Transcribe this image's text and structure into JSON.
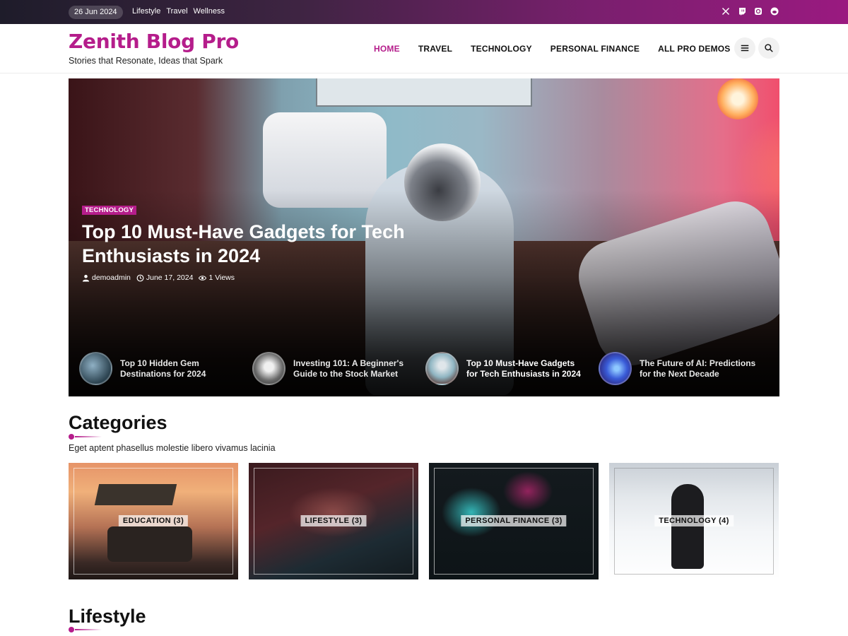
{
  "topbar": {
    "date": "26 Jun 2024",
    "links": [
      "Lifestyle",
      "Travel",
      "Wellness"
    ],
    "socials": [
      "x-icon",
      "twitch-icon",
      "instagram-icon",
      "reddit-icon"
    ]
  },
  "header": {
    "brand_title": "Zenith Blog Pro",
    "tagline": "Stories that Resonate, Ideas that Spark",
    "nav": [
      {
        "label": "HOME",
        "active": true
      },
      {
        "label": "TRAVEL",
        "active": false
      },
      {
        "label": "TECHNOLOGY",
        "active": false
      },
      {
        "label": "PERSONAL FINANCE",
        "active": false
      },
      {
        "label": "ALL PRO DEMOS",
        "active": false,
        "has_dropdown": true
      }
    ],
    "buttons": [
      "hamburger-menu-icon",
      "search-icon"
    ]
  },
  "hero": {
    "category": "TECHNOLOGY",
    "title": "Top 10 Must-Have Gadgets for Tech Enthusiasts in 2024",
    "author": "demoadmin",
    "date": "June 17, 2024",
    "views": "1 Views",
    "thumbs": [
      {
        "title": "Top 10 Hidden Gem Destinations for 2024",
        "current": false
      },
      {
        "title": "Investing 101: A Beginner's Guide to the Stock Market",
        "current": false
      },
      {
        "title": "Top 10 Must-Have Gadgets for Tech Enthusiasts in 2024",
        "current": true
      },
      {
        "title": "The Future of AI: Predictions for the Next Decade",
        "current": false
      }
    ]
  },
  "categories": {
    "title": "Categories",
    "subtitle": "Eget aptent phasellus molestie libero vivamus lacinia",
    "items": [
      {
        "label": "EDUCATION (3)"
      },
      {
        "label": "LIFESTYLE (3)"
      },
      {
        "label": "PERSONAL FINANCE (3)"
      },
      {
        "label": "TECHNOLOGY (4)"
      }
    ]
  },
  "lifestyle": {
    "title": "Lifestyle"
  },
  "colors": {
    "accent": "#b51d8b",
    "topbar_start": "#1e1c2a",
    "topbar_end": "#9a1a80"
  }
}
